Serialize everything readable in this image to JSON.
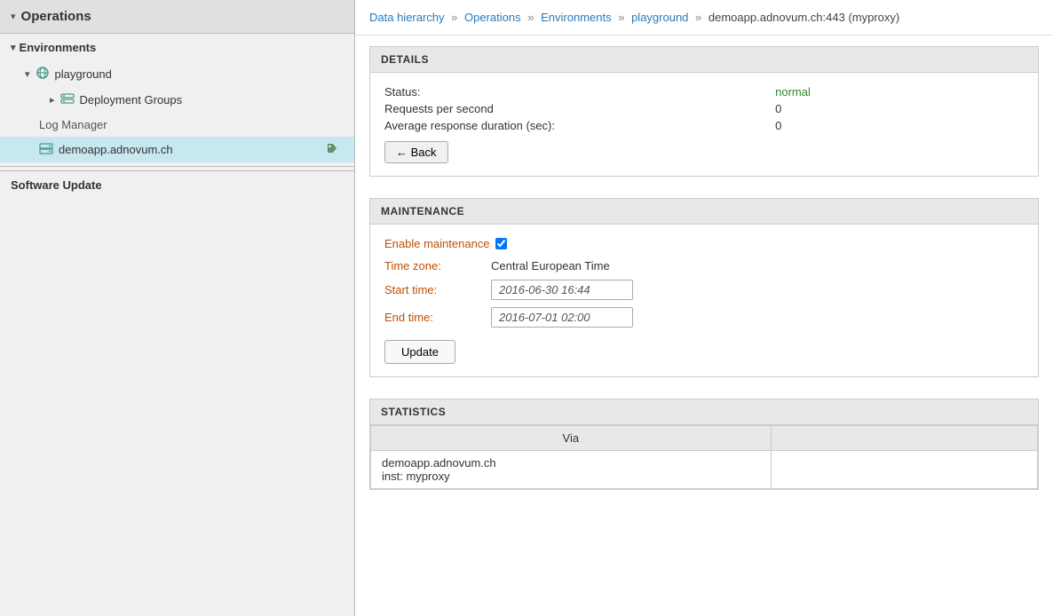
{
  "sidebar": {
    "title": "Operations",
    "sections": {
      "environments": {
        "label": "Environments",
        "items": {
          "playground": {
            "label": "playground",
            "children": {
              "deploymentGroups": {
                "label": "Deployment Groups"
              }
            }
          },
          "logManager": {
            "label": "Log Manager"
          },
          "demoapp": {
            "label": "demoapp.adnovum.ch",
            "active": true
          }
        }
      },
      "softwareUpdate": {
        "label": "Software Update"
      }
    }
  },
  "breadcrumb": {
    "items": [
      {
        "label": "Data hierarchy",
        "link": true
      },
      {
        "label": "Operations",
        "link": true
      },
      {
        "label": "Environments",
        "link": true
      },
      {
        "label": "playground",
        "link": true
      },
      {
        "label": "demoapp.adnovum.ch:443 (myproxy)",
        "link": false
      }
    ]
  },
  "details": {
    "section_title": "DETAILS",
    "fields": [
      {
        "label": "Status:",
        "value": "normal",
        "status": true
      },
      {
        "label": "Requests per second",
        "value": "0",
        "status": false
      },
      {
        "label": "Average response duration (sec):",
        "value": "0",
        "status": false
      }
    ],
    "back_button": "← Back"
  },
  "maintenance": {
    "section_title": "MAINTENANCE",
    "enable_label": "Enable maintenance",
    "fields": [
      {
        "label": "Time zone:",
        "value": "Central European Time"
      },
      {
        "label": "Start time:",
        "value": "2016-06-30 16:44"
      },
      {
        "label": "End time:",
        "value": "2016-07-01 02:00"
      }
    ],
    "update_button": "Update"
  },
  "statistics": {
    "section_title": "STATISTICS",
    "columns": [
      "Via",
      ""
    ],
    "rows": [
      {
        "via": "demoapp.adnovum.ch\ninst: myproxy",
        "data": ""
      }
    ]
  }
}
